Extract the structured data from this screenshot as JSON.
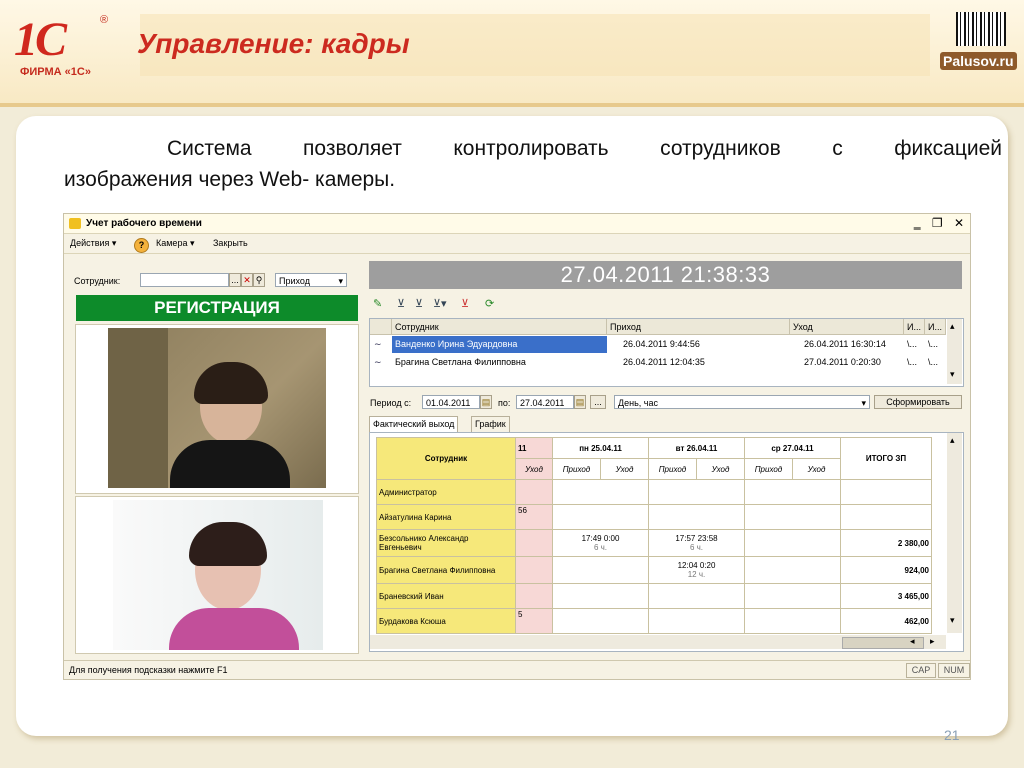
{
  "slide": {
    "title": "Управление: кадры",
    "logo_main": "1С",
    "logo_sub": "ФИРМА «1С»",
    "logo_reg": "®",
    "partner_logo": "Palusov.ru",
    "description_line1": "Система позволяет контролировать сотрудников с фиксацией",
    "description_line2": "изображения через Web- камеры.",
    "page_number": "21"
  },
  "window": {
    "title": "Учет рабочего времени",
    "menu": {
      "actions": "Действия ▾",
      "help": "?",
      "camera": "Камера ▾",
      "close": "Закрыть"
    },
    "employee_label": "Сотрудник:",
    "employee_value": "",
    "ellipsis": "...",
    "direction_value": "Приход",
    "registration": "РЕГИСТРАЦИЯ",
    "datetime": "27.04.2011 21:38:33",
    "log": {
      "columns": [
        "Сотрудник",
        "Приход",
        "Уход",
        "И...",
        "И..."
      ],
      "rows": [
        {
          "employee": "Ванденко Ирина Эдуардовна",
          "in": "26.04.2011 9:44:56",
          "out": "26.04.2011 16:30:14",
          "c1": "\\...",
          "c2": "\\..."
        },
        {
          "employee": "Брагина Светлана Филипповна",
          "in": "26.04.2011 12:04:35",
          "out": "27.04.2011 0:20:30",
          "c1": "\\...",
          "c2": "\\..."
        }
      ]
    },
    "period": {
      "from_label": "Период с:",
      "from": "01.04.2011",
      "to_label": "по:",
      "to": "27.04.2011",
      "dots": "...",
      "granularity": "День, час",
      "build_button": "Сформировать"
    },
    "tabs": [
      "Фактический выход",
      "График"
    ],
    "report": {
      "employee_header": "Сотрудник",
      "hour_header": "11",
      "leave": "Уход",
      "arrive": "Приход",
      "days": [
        "пн 25.04.11",
        "вт 26.04.11",
        "ср 27.04.11"
      ],
      "total_header": "ИТОГО ЗП",
      "rows": [
        {
          "name": "Администратор",
          "h": "",
          "d1": "",
          "d1b": "",
          "d2": "",
          "d2b": "",
          "d3": "",
          "total": ""
        },
        {
          "name": "Айзатулина Карина",
          "h": "56",
          "d1": "",
          "d1b": "",
          "d2": "",
          "d2b": "",
          "d3": "",
          "total": ""
        },
        {
          "name": "Безсольнико Александр Евгеньевич",
          "h": "",
          "d1": "17:49  0:00",
          "d1b": "6 ч.",
          "d2": "17:57  23:58",
          "d2b": "6 ч.",
          "d3": "",
          "total": "2 380,00"
        },
        {
          "name": "Брагина Светлана Филипповна",
          "h": "",
          "d1": "",
          "d1b": "",
          "d2": "12:04  0:20",
          "d2b": "12 ч.",
          "d3": "",
          "total": "924,00"
        },
        {
          "name": "Браневский Иван",
          "h": "",
          "d1": "",
          "d1b": "",
          "d2": "",
          "d2b": "",
          "d3": "",
          "total": "3 465,00"
        },
        {
          "name": "Бурдакова Ксюша",
          "h": "5",
          "d1": "",
          "d1b": "",
          "d2": "",
          "d2b": "",
          "d3": "",
          "total": "462,00"
        }
      ]
    },
    "status": {
      "hint": "Для получения подсказки нажмите F1",
      "cap": "CAP",
      "num": "NUM"
    }
  }
}
